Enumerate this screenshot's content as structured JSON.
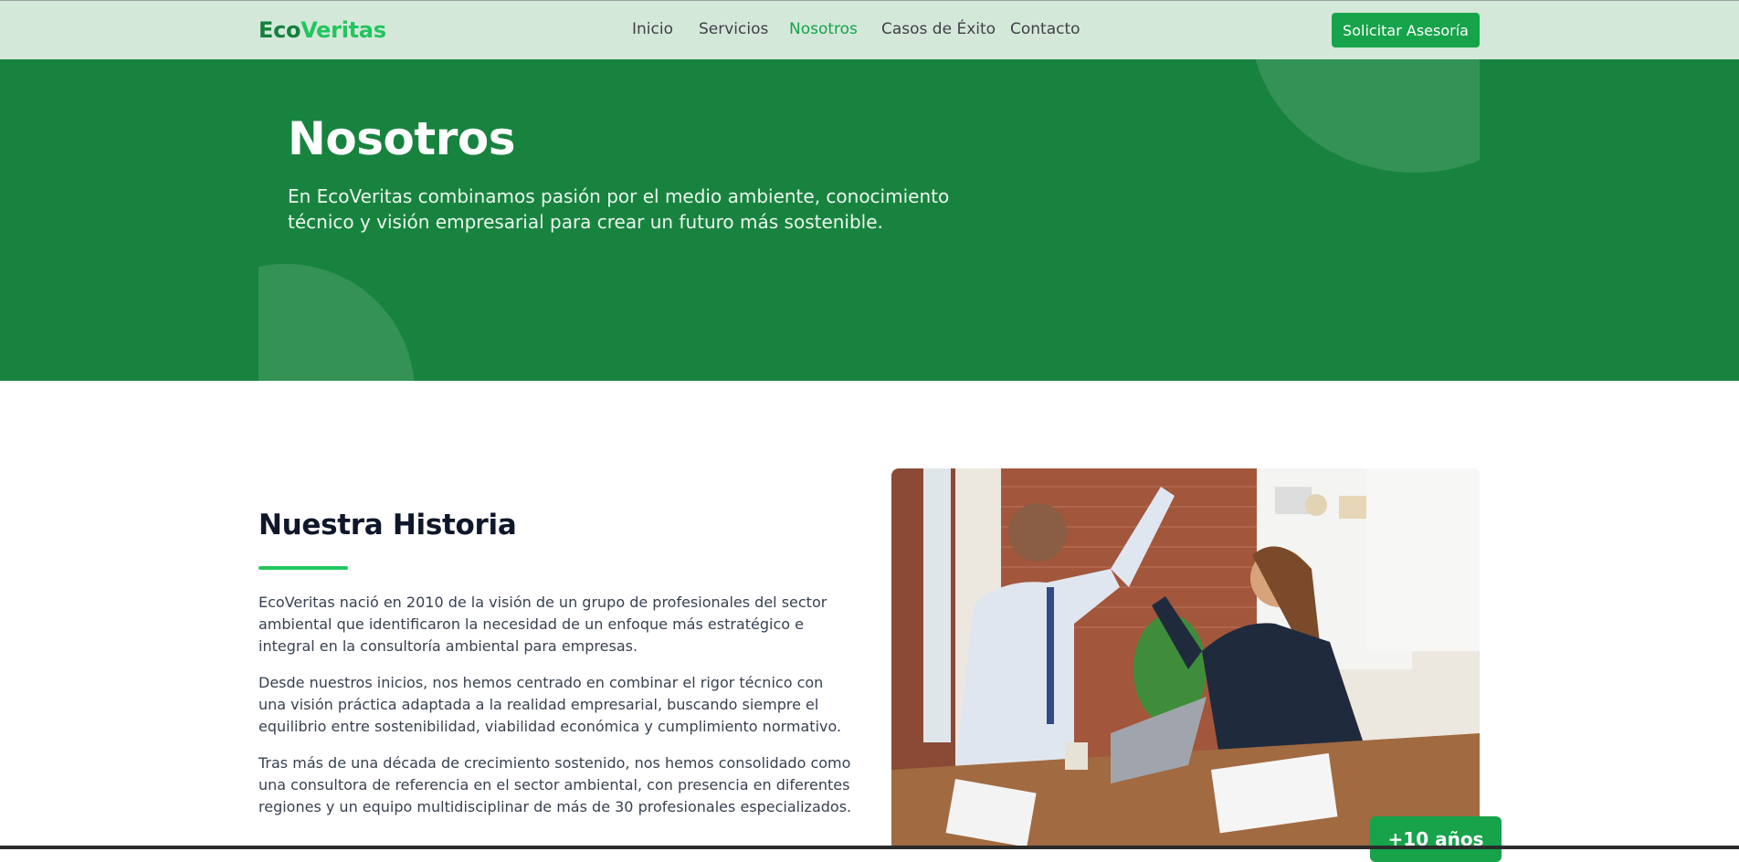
{
  "navbar": {
    "logo": {
      "part1": "Eco",
      "part2": "Veritas"
    },
    "links": [
      {
        "label": "Inicio",
        "active": false
      },
      {
        "label": "Servicios",
        "active": false
      },
      {
        "label": "Nosotros",
        "active": true
      },
      {
        "label": "Casos de Éxito",
        "active": false
      },
      {
        "label": "Contacto",
        "active": false
      }
    ],
    "cta_label": "Solicitar Asesoría"
  },
  "hero": {
    "title": "Nosotros",
    "subtitle": "En EcoVeritas combinamos pasión por el medio ambiente, conocimiento técnico y visión empresarial para crear un futuro más sostenible."
  },
  "history": {
    "title": "Nuestra Historia",
    "paragraphs": [
      "EcoVeritas nació en 2010 de la visión de un grupo de profesionales del sector ambiental que identificaron la necesidad de un enfoque más estratégico e integral en la consultoría ambiental para empresas.",
      "Desde nuestros inicios, nos hemos centrado en combinar el rigor técnico con una visión práctica adaptada a la realidad empresarial, buscando siempre el equilibrio entre sostenibilidad, viabilidad económica y cumplimiento normativo.",
      "Tras más de una década de crecimiento sostenido, nos hemos consolidado como una consultora de referencia en el sector ambiental, con presencia en diferentes regiones y un equipo multidisciplinar de más de 30 profesionales especializados."
    ],
    "badge": "+10 años"
  },
  "colors": {
    "brand_dark": "#15803d",
    "brand_light": "#22c55e",
    "hero_bg": "#18833f",
    "navbar_bg": "#d4e8da",
    "button_bg": "#16a34a"
  }
}
